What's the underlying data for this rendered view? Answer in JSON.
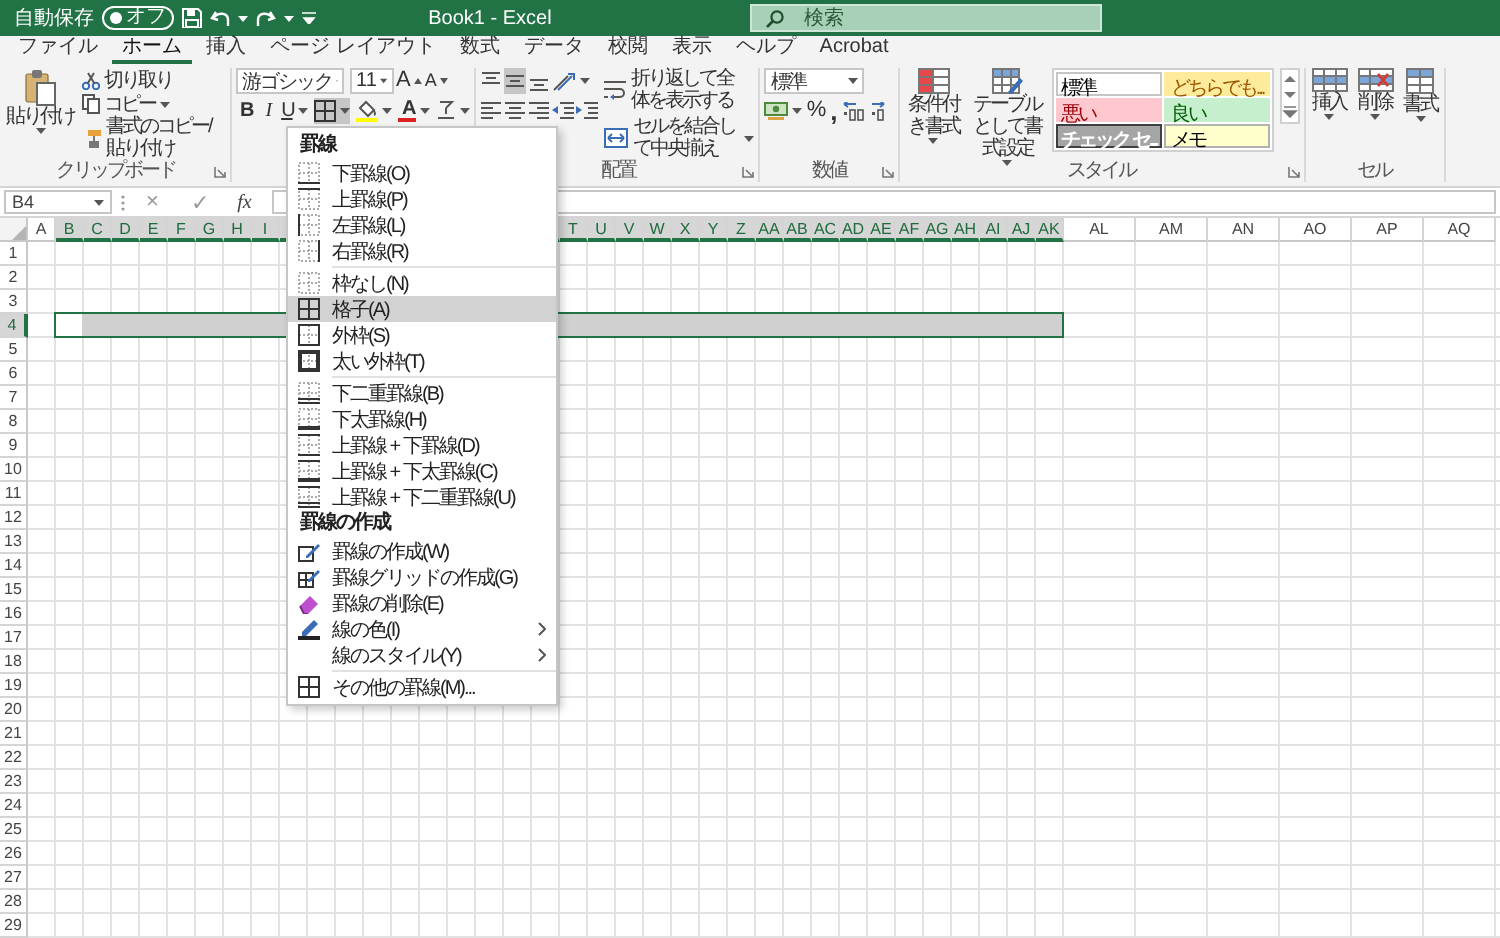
{
  "title_bar": {
    "autosave": {
      "label": "自動保存",
      "on": false,
      "state": "オフ"
    },
    "title": "Book1 - Excel",
    "search": {
      "placeholder": "検索"
    }
  },
  "tabs": [
    {
      "label": "ファイル",
      "selected": false
    },
    {
      "label": "ホーム",
      "selected": true
    },
    {
      "label": "挿入",
      "selected": false
    },
    {
      "label": "ページ レイアウト",
      "selected": false
    },
    {
      "label": "数式",
      "selected": false
    },
    {
      "label": "データ",
      "selected": false
    },
    {
      "label": "校閲",
      "selected": false
    },
    {
      "label": "表示",
      "selected": false
    },
    {
      "label": "ヘルプ",
      "selected": false
    },
    {
      "label": "Acrobat",
      "selected": false
    }
  ],
  "ribbon": {
    "clipboard": {
      "paste": "貼り付け",
      "cut": "切り取り",
      "copy": "コピー",
      "format_painter": "書式のコピー/貼り付け",
      "label": "クリップボード"
    },
    "font": {
      "name": "游ゴシック",
      "size": "11",
      "grow": "A",
      "shrink": "A",
      "bold": "B",
      "italic": "I",
      "underline": "U",
      "border_button": {
        "open": true
      },
      "font_color": "A"
    },
    "alignment": {
      "vertical": [
        {
          "kind": "top",
          "selected": false
        },
        {
          "kind": "middle",
          "selected": true
        },
        {
          "kind": "bottom",
          "selected": false
        }
      ],
      "horizontal": [
        {
          "kind": "left",
          "selected": false
        },
        {
          "kind": "center",
          "selected": false
        },
        {
          "kind": "right",
          "selected": false
        }
      ],
      "wrap_text": "折り返して全体を表示する",
      "merge": "セルを結合して中央揃え",
      "label": "配置"
    },
    "number": {
      "format": "標準",
      "percent": "%",
      "comma": ",",
      "label": "数値"
    },
    "styles": {
      "conditional": "条件付き書式",
      "table": "テーブルとして書式設定",
      "gallery": [
        {
          "label": "標準",
          "kind": "normal"
        },
        {
          "label": "どちらでも...",
          "kind": "neutral"
        },
        {
          "label": "悪い",
          "kind": "bad"
        },
        {
          "label": "良い",
          "kind": "good"
        },
        {
          "label": "チェック セ...",
          "kind": "check"
        },
        {
          "label": "メモ",
          "kind": "note"
        }
      ],
      "label": "スタイル"
    },
    "cells": {
      "insert": "挿入",
      "delete": "削除",
      "format": "書式",
      "label": "セル"
    }
  },
  "formula_bar": {
    "name_box": "B4",
    "cancel": "×",
    "enter": "✓",
    "function": "fx"
  },
  "sheet": {
    "columns_left": [
      {
        "label": "A",
        "kind": "narrow",
        "selected": false
      },
      {
        "label": "B",
        "kind": "narrow",
        "selected": true
      },
      {
        "label": "C",
        "kind": "narrow",
        "selected": true
      },
      {
        "label": "D",
        "kind": "narrow",
        "selected": true
      },
      {
        "label": "E",
        "kind": "narrow",
        "selected": true
      },
      {
        "label": "F",
        "kind": "narrow",
        "selected": true
      },
      {
        "label": "G",
        "kind": "narrow",
        "selected": true
      },
      {
        "label": "H",
        "kind": "narrow",
        "selected": true
      },
      {
        "label": "I",
        "kind": "narrow",
        "selected": true
      }
    ],
    "columns_right": [
      {
        "label": "T",
        "kind": "narrow",
        "selected": true
      },
      {
        "label": "U",
        "kind": "narrow",
        "selected": true
      },
      {
        "label": "V",
        "kind": "narrow",
        "selected": true
      },
      {
        "label": "W",
        "kind": "narrow",
        "selected": true
      },
      {
        "label": "X",
        "kind": "narrow",
        "selected": true
      },
      {
        "label": "Y",
        "kind": "narrow",
        "selected": true
      },
      {
        "label": "Z",
        "kind": "narrow",
        "selected": true
      },
      {
        "label": "AA",
        "kind": "narrow",
        "selected": true
      },
      {
        "label": "AB",
        "kind": "narrow",
        "selected": true
      },
      {
        "label": "AC",
        "kind": "narrow",
        "selected": true
      },
      {
        "label": "AD",
        "kind": "narrow",
        "selected": true
      },
      {
        "label": "AE",
        "kind": "narrow",
        "selected": true
      },
      {
        "label": "AF",
        "kind": "narrow",
        "selected": true
      },
      {
        "label": "AG",
        "kind": "narrow",
        "selected": true
      },
      {
        "label": "AH",
        "kind": "narrow",
        "selected": true
      },
      {
        "label": "AI",
        "kind": "narrow",
        "selected": true
      },
      {
        "label": "AJ",
        "kind": "narrow",
        "selected": true
      },
      {
        "label": "AK",
        "kind": "narrow",
        "selected": true
      },
      {
        "label": "AL",
        "kind": "wide",
        "selected": false
      },
      {
        "label": "AM",
        "kind": "wide",
        "selected": false
      },
      {
        "label": "AN",
        "kind": "wide",
        "selected": false
      },
      {
        "label": "AO",
        "kind": "wide",
        "selected": false
      },
      {
        "label": "AP",
        "kind": "wide",
        "selected": false
      },
      {
        "label": "AQ",
        "kind": "wide",
        "selected": false
      }
    ],
    "rows": [
      {
        "label": "1",
        "selected": false
      },
      {
        "label": "2",
        "selected": false
      },
      {
        "label": "3",
        "selected": false
      },
      {
        "label": "4",
        "selected": true
      },
      {
        "label": "5",
        "selected": false
      },
      {
        "label": "6",
        "selected": false
      },
      {
        "label": "7",
        "selected": false
      },
      {
        "label": "8",
        "selected": false
      },
      {
        "label": "9",
        "selected": false
      },
      {
        "label": "10",
        "selected": false
      },
      {
        "label": "11",
        "selected": false
      },
      {
        "label": "12",
        "selected": false
      },
      {
        "label": "13",
        "selected": false
      },
      {
        "label": "14",
        "selected": false
      },
      {
        "label": "15",
        "selected": false
      },
      {
        "label": "16",
        "selected": false
      },
      {
        "label": "17",
        "selected": false
      },
      {
        "label": "18",
        "selected": false
      },
      {
        "label": "19",
        "selected": false
      },
      {
        "label": "20",
        "selected": false
      },
      {
        "label": "21",
        "selected": false
      },
      {
        "label": "22",
        "selected": false
      },
      {
        "label": "23",
        "selected": false
      },
      {
        "label": "24",
        "selected": false
      },
      {
        "label": "25",
        "selected": false
      },
      {
        "label": "26",
        "selected": false
      },
      {
        "label": "27",
        "selected": false
      },
      {
        "label": "28",
        "selected": false
      },
      {
        "label": "29",
        "selected": false
      }
    ]
  },
  "border_menu": {
    "items": [
      {
        "kind": "header",
        "label": "罫線"
      },
      {
        "kind": "bottom",
        "label": "下罫線(O)",
        "highlighted": false,
        "submenu": false
      },
      {
        "kind": "top",
        "label": "上罫線(P)",
        "highlighted": false,
        "submenu": false
      },
      {
        "kind": "left",
        "label": "左罫線(L)",
        "highlighted": false,
        "submenu": false
      },
      {
        "kind": "right",
        "label": "右罫線(R)",
        "highlighted": false,
        "submenu": false
      },
      {
        "kind": "separator"
      },
      {
        "kind": "none",
        "label": "枠なし(N)",
        "highlighted": false,
        "submenu": false
      },
      {
        "kind": "all",
        "label": "格子(A)",
        "highlighted": true,
        "submenu": false
      },
      {
        "kind": "outside",
        "label": "外枠(S)",
        "highlighted": false,
        "submenu": false
      },
      {
        "kind": "thick_outside",
        "label": "太い外枠(T)",
        "highlighted": false,
        "submenu": false
      },
      {
        "kind": "separator"
      },
      {
        "kind": "double_bottom",
        "label": "下二重罫線(B)",
        "highlighted": false,
        "submenu": false
      },
      {
        "kind": "thick_bottom",
        "label": "下太罫線(H)",
        "highlighted": false,
        "submenu": false
      },
      {
        "kind": "top_bottom",
        "label": "上罫線 + 下罫線(D)",
        "highlighted": false,
        "submenu": false
      },
      {
        "kind": "top_thick_bottom",
        "label": "上罫線 + 下太罫線(C)",
        "highlighted": false,
        "submenu": false
      },
      {
        "kind": "top_double_bottom",
        "label": "上罫線 + 下二重罫線(U)",
        "highlighted": false,
        "submenu": false
      },
      {
        "kind": "header",
        "label": "罫線の作成"
      },
      {
        "kind": "draw",
        "label": "罫線の作成(W)",
        "highlighted": false,
        "submenu": false
      },
      {
        "kind": "draw_grid",
        "label": "罫線グリッドの作成(G)",
        "highlighted": false,
        "submenu": false
      },
      {
        "kind": "erase",
        "label": "罫線の削除(E)",
        "highlighted": false,
        "submenu": false
      },
      {
        "kind": "line_color",
        "label": "線の色(I)",
        "highlighted": false,
        "submenu": true
      },
      {
        "kind": "line_style",
        "label": "線のスタイル(Y)",
        "highlighted": false,
        "submenu": true
      },
      {
        "kind": "separator"
      },
      {
        "kind": "more",
        "label": "その他の罫線(M)...",
        "highlighted": false,
        "submenu": false
      }
    ]
  }
}
